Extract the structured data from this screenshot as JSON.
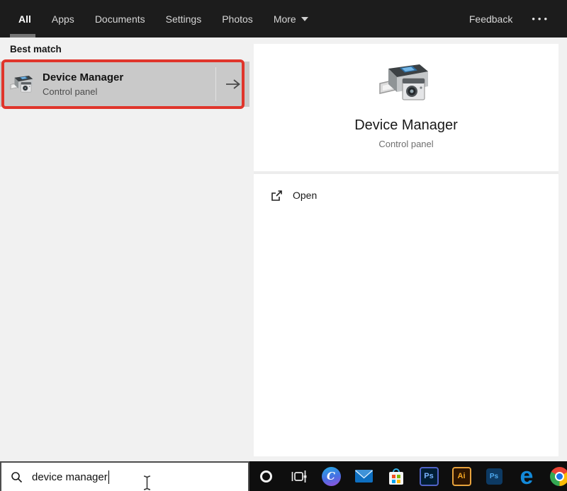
{
  "header": {
    "tabs": [
      {
        "label": "All",
        "active": true
      },
      {
        "label": "Apps",
        "active": false
      },
      {
        "label": "Documents",
        "active": false
      },
      {
        "label": "Settings",
        "active": false
      },
      {
        "label": "Photos",
        "active": false
      }
    ],
    "more_label": "More",
    "feedback_label": "Feedback",
    "overflow_dots": "•••"
  },
  "left_panel": {
    "section_header": "Best match",
    "best_match_item": {
      "title": "Device Manager",
      "subtitle": "Control panel",
      "icon": "device-manager-icon",
      "annotation": {
        "type": "highlight-box",
        "color": "#e0352b"
      }
    }
  },
  "right_panel": {
    "hero": {
      "title": "Device Manager",
      "subtitle": "Control panel",
      "icon": "device-manager-icon"
    },
    "actions": [
      {
        "label": "Open",
        "icon": "open-icon"
      }
    ]
  },
  "search_bar": {
    "icon": "search-icon",
    "value": "device manager"
  },
  "taskbar": {
    "icons": [
      "cortana-ring",
      "task-view",
      "cortana",
      "mail",
      "microsoft-store",
      "photoshop",
      "illustrator",
      "photoshop-express",
      "edge",
      "chrome"
    ],
    "cortana_label": "C",
    "photoshop_label": "Ps",
    "illustrator_label": "Ai",
    "photoshop_express_label": "Ps",
    "edge_label": "e"
  },
  "colors": {
    "header_bg": "#1c1c1c",
    "taskbar_bg": "#0e0e0e",
    "highlight_bg": "#c9c9c9",
    "annotation_red": "#e0352b",
    "panel_bg": "#f1f1f1"
  }
}
